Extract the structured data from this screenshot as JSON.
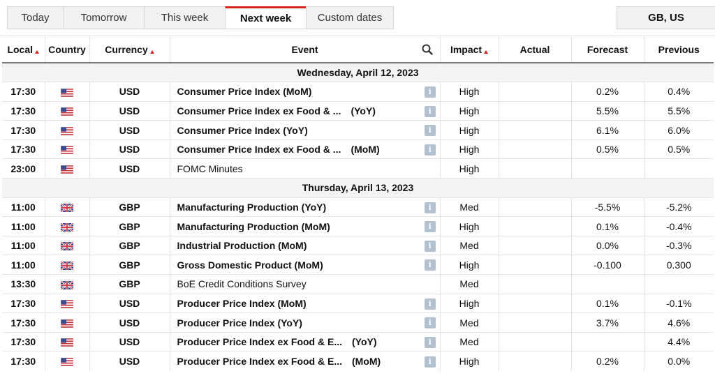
{
  "tabs": [
    {
      "label": "Today",
      "active": false
    },
    {
      "label": "Tomorrow",
      "active": false
    },
    {
      "label": "This week",
      "active": false
    },
    {
      "label": "Next week",
      "active": true
    },
    {
      "label": "Custom dates",
      "active": false
    }
  ],
  "region_label": "GB, US",
  "columns": {
    "local": "Local",
    "country": "Country",
    "currency": "Currency",
    "event": "Event",
    "impact": "Impact",
    "actual": "Actual",
    "forecast": "Forecast",
    "previous": "Previous"
  },
  "groups": [
    {
      "date": "Wednesday, April 12, 2023",
      "rows": [
        {
          "time": "17:30",
          "flag": "us-flag",
          "currency": "USD",
          "event": "Consumer Price Index (MoM)",
          "period": "",
          "bold": true,
          "info": true,
          "impact": "High",
          "actual": "",
          "forecast": "0.2%",
          "previous": "0.4%"
        },
        {
          "time": "17:30",
          "flag": "us-flag",
          "currency": "USD",
          "event": "Consumer Price Index ex Food & ...",
          "period": "(YoY)",
          "bold": true,
          "info": true,
          "impact": "High",
          "actual": "",
          "forecast": "5.5%",
          "previous": "5.5%"
        },
        {
          "time": "17:30",
          "flag": "us-flag",
          "currency": "USD",
          "event": "Consumer Price Index (YoY)",
          "period": "",
          "bold": true,
          "info": true,
          "impact": "High",
          "actual": "",
          "forecast": "6.1%",
          "previous": "6.0%"
        },
        {
          "time": "17:30",
          "flag": "us-flag",
          "currency": "USD",
          "event": "Consumer Price Index ex Food & ...",
          "period": "(MoM)",
          "bold": true,
          "info": true,
          "impact": "High",
          "actual": "",
          "forecast": "0.5%",
          "previous": "0.5%"
        },
        {
          "time": "23:00",
          "flag": "us-flag",
          "currency": "USD",
          "event": "FOMC Minutes",
          "period": "",
          "bold": false,
          "info": false,
          "impact": "High",
          "actual": "",
          "forecast": "",
          "previous": ""
        }
      ]
    },
    {
      "date": "Thursday, April 13, 2023",
      "rows": [
        {
          "time": "11:00",
          "flag": "uk-flag",
          "currency": "GBP",
          "event": "Manufacturing Production (YoY)",
          "period": "",
          "bold": true,
          "info": true,
          "impact": "Med",
          "actual": "",
          "forecast": "-5.5%",
          "previous": "-5.2%"
        },
        {
          "time": "11:00",
          "flag": "uk-flag",
          "currency": "GBP",
          "event": "Manufacturing Production (MoM)",
          "period": "",
          "bold": true,
          "info": true,
          "impact": "High",
          "actual": "",
          "forecast": "0.1%",
          "previous": "-0.4%"
        },
        {
          "time": "11:00",
          "flag": "uk-flag",
          "currency": "GBP",
          "event": "Industrial Production (MoM)",
          "period": "",
          "bold": true,
          "info": true,
          "impact": "Med",
          "actual": "",
          "forecast": "0.0%",
          "previous": "-0.3%"
        },
        {
          "time": "11:00",
          "flag": "uk-flag",
          "currency": "GBP",
          "event": "Gross Domestic Product (MoM)",
          "period": "",
          "bold": true,
          "info": true,
          "impact": "High",
          "actual": "",
          "forecast": "-0.100",
          "previous": "0.300"
        },
        {
          "time": "13:30",
          "flag": "uk-flag",
          "currency": "GBP",
          "event": "BoE Credit Conditions Survey",
          "period": "",
          "bold": false,
          "info": false,
          "impact": "Med",
          "actual": "",
          "forecast": "",
          "previous": ""
        },
        {
          "time": "17:30",
          "flag": "us-flag",
          "currency": "USD",
          "event": "Producer Price Index (MoM)",
          "period": "",
          "bold": true,
          "info": true,
          "impact": "High",
          "actual": "",
          "forecast": "0.1%",
          "previous": "-0.1%"
        },
        {
          "time": "17:30",
          "flag": "us-flag",
          "currency": "USD",
          "event": "Producer Price Index (YoY)",
          "period": "",
          "bold": true,
          "info": true,
          "impact": "Med",
          "actual": "",
          "forecast": "3.7%",
          "previous": "4.6%"
        },
        {
          "time": "17:30",
          "flag": "us-flag",
          "currency": "USD",
          "event": "Producer Price Index ex Food & E...",
          "period": "(YoY)",
          "bold": true,
          "info": true,
          "impact": "Med",
          "actual": "",
          "forecast": "",
          "previous": "4.4%"
        },
        {
          "time": "17:30",
          "flag": "us-flag",
          "currency": "USD",
          "event": "Producer Price Index ex Food & E...",
          "period": "(MoM)",
          "bold": true,
          "info": true,
          "impact": "High",
          "actual": "",
          "forecast": "0.2%",
          "previous": "0.0%"
        }
      ]
    }
  ],
  "colors": {
    "accent": "#d9261c",
    "info_icon": "#b2c0d0",
    "date_row_bg": "#f4f4f4"
  }
}
